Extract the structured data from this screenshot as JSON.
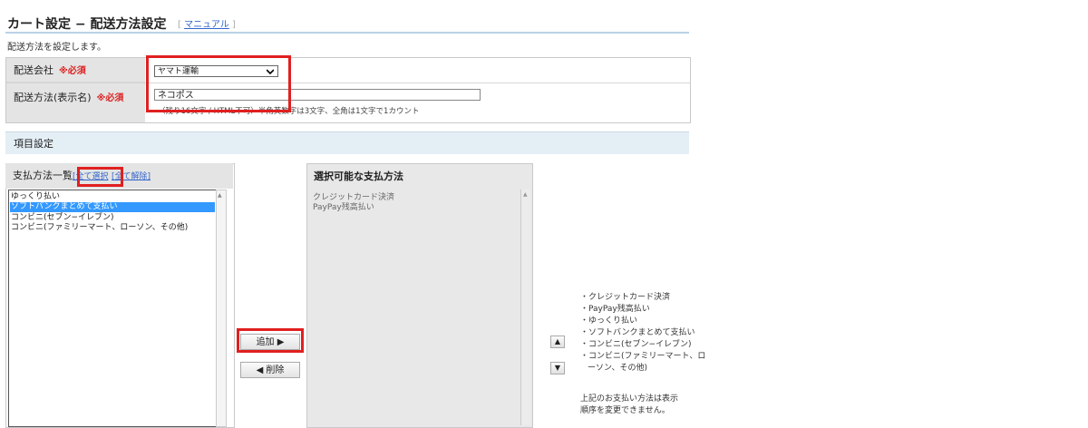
{
  "header": {
    "title": "カート設定 − 配送方法設定",
    "manual_link": "マニュアル",
    "description": "配送方法を設定します。"
  },
  "form": {
    "carrier_label": "配送会社",
    "carrier_required": "※必須",
    "carrier_value": "ヤマト運輸",
    "method_label": "配送方法(表示名)",
    "method_required": "※必須",
    "method_value": "ネコポス",
    "method_hint": "（残り16文字 / HTML不可）半角英数字は3文字、全角は1文字で1カウント"
  },
  "section": {
    "title": "項目設定"
  },
  "payment_list": {
    "title": "支払方法一覧",
    "select_all": "[全て選択",
    "deselect_all": "[全て解除]",
    "items": [
      {
        "label": "ゆっくり払い"
      },
      {
        "label": "ソフトバンクまとめて支払い"
      },
      {
        "label": "コンビニ(セブン−イレブン)"
      },
      {
        "label": "コンビニ(ファミリーマート、ローソン、その他)"
      }
    ],
    "selected_index": 1
  },
  "available_list": {
    "title": "選択可能な支払方法",
    "items": [
      {
        "label": "クレジットカード決済"
      },
      {
        "label": "PayPay残高払い"
      }
    ]
  },
  "actions": {
    "add": "追加 ▶",
    "remove": "◀ 削除"
  },
  "order": {
    "items": [
      "・クレジットカード決済",
      "・PayPay残高払い",
      "・ゆっくり払い",
      "・ソフトバンクまとめて支払い",
      "・コンビニ(セブン−イレブン)",
      "・コンビニ(ファミリーマート、ロ",
      "ーソン、その他)"
    ],
    "note_line1": "上記のお支払い方法は表示",
    "note_line2": "順序を変更できません。"
  },
  "icons": {
    "dropdown": "chevron-down-icon",
    "move_up": "triangle-up-icon",
    "move_down": "triangle-down-icon"
  },
  "colors": {
    "highlight_box": "#e02020",
    "selected_row": "#3399ff",
    "link": "#3366cc",
    "required": "#dd2222"
  }
}
